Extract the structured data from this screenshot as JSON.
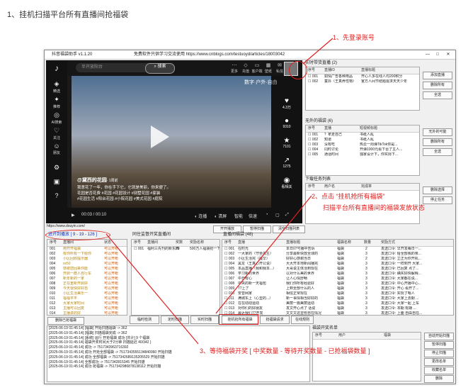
{
  "heading": "1、挂机扫描平台所有直播间抢福袋",
  "window": {
    "title": "抖音福袋助手 v1.1.20",
    "subtitle": "免费软件只供学习交流使用 https://www.cnblogs.com/testuoyd/articles/18003042"
  },
  "douyin": {
    "search_placeholder": "半开放阳台",
    "search_button": "搜索",
    "nav": [
      "精选",
      "推荐",
      "AI搜索",
      "关注",
      "朋友",
      "",
      "",
      ""
    ],
    "top_icons": [
      "更多",
      "充值",
      "客户端",
      "壁纸",
      "私信",
      "投稿"
    ],
    "overlay_title": "数字·户外·自由",
    "rail": [
      {
        "icon": "♥",
        "label": "4.3万"
      },
      {
        "icon": "●",
        "label": "9310"
      },
      {
        "icon": "★",
        "label": "7101"
      },
      {
        "icon": "↗",
        "label": "1275"
      },
      {
        "icon": "◉",
        "label": "看相关"
      }
    ],
    "author": "@黛西的花园",
    "author_time": "· 1周前",
    "caption1": "我意花了一年，你在手下它，它就是美丽，你来便了。",
    "caption2": "花园是否花费 #花园 #花园设计 #别墅花园 #家装",
    "caption3": "#花园生活 #阳台花园 #小院花园  #美式花园 #庭院",
    "time": "00:03 / 00:10",
    "controls": [
      "连播",
      "清屏",
      "智能",
      "倍速"
    ],
    "url": "https://www.douyin.com/"
  },
  "live": {
    "title": "实时带货直播 (2)",
    "headers": [
      "序号",
      "直播ID",
      "直播标题"
    ],
    "rows": [
      [
        "001",
        "如情广告各种用品",
        "开心人多在线人均200积分"
      ],
      [
        "002",
        "童抖（王真养性物）",
        "官方人间节结题需求天天少年"
      ]
    ],
    "buttons": [
      "添加直播",
      "删除所有",
      "全选"
    ]
  },
  "bags": {
    "title": "无外的福袋 (6)",
    "headers": [
      "序号",
      "直播",
      "短视频标题"
    ],
    "rows": [
      [
        "001",
        "？拿走自己",
        "书纸人乱"
      ],
      [
        "002",
        "知道",
        "书纸人乱"
      ],
      [
        "003",
        "没有吃",
        "热云一周弹TikTok你是..."
      ],
      [
        "004",
        "同时讨论",
        "开弹1000元看下台了主人..."
      ],
      [
        "005",
        "通话时间",
        "独家设计下，你实际下..."
      ]
    ],
    "buttons": [
      "无外的可能",
      "删除所有",
      "全选"
    ]
  },
  "download": {
    "title": "下载任务列表",
    "headers": [
      "序号",
      "用户名",
      "完成率"
    ],
    "buttons": [
      "删除选择",
      "停止任务"
    ]
  },
  "progress": {
    "label": "进开到播放 [ 9 - 19 - 126 ]",
    "headers": [
      "序号",
      "直播间",
      "状态"
    ],
    "rows": [
      [
        "001",
        "用开开福袋",
        "可以开枪"
      ],
      [
        "002",
        "有你所有一下给你",
        "可以开枪"
      ],
      [
        "003",
        "小区回收提示器",
        "可以开枪"
      ],
      [
        "004",
        "xx50",
        "可以开枪"
      ],
      [
        "005",
        "感谢您回来你能",
        "可以开枪"
      ],
      [
        "006",
        "开启一群人自行车",
        "可以开枪"
      ],
      [
        "007",
        "新年新的一家",
        "可以开枪"
      ],
      [
        "008",
        "正在重新开启好",
        "可以开枪"
      ],
      [
        "009",
        "今天很快好好自",
        "可以开枪"
      ],
      [
        "010",
        "小区生活美乐一",
        "可以开枪"
      ],
      [
        "011",
        "福福平平",
        "可以开枪"
      ],
      [
        "012",
        "大家大家时间",
        "可以开枪"
      ],
      [
        "013",
        "主播可以回复",
        "可以开枪"
      ],
      [
        "014",
        "主播讲的好",
        "可以开枪"
      ]
    ],
    "button": "删除已抢福袋"
  },
  "listen": {
    "title": "同住监督开奖直播间",
    "headers": [
      "序号",
      "直播间",
      "奖数",
      "奖励名称"
    ],
    "rows": [
      [
        "001",
        "福利三先刊的新东西",
        "20",
        "500万人福袋抢一下"
      ]
    ]
  },
  "bag_list": {
    "title": "直播间福袋 (48)",
    "headers": [
      "序号",
      "直播",
      "直播标题",
      "福袋名称",
      "数量",
      "奖励方式"
    ],
    "rows": [
      [
        "001",
        "在时光",
        "本日07号播中告诉",
        "福袋",
        "2",
        "发送口令: 早开发每日一..."
      ],
      [
        "002",
        "一大家的（守坐先生）",
        "分享最新快放全球的",
        "福袋",
        "3",
        "发送口令: 给全部我的亲..."
      ],
      [
        "003",
        "小区生活完（提早）",
        "好好心感谢当日",
        "福袋",
        "2",
        "发送口令: 立正为你开机..."
      ],
      [
        "004",
        "黑龙（王真心开公说）",
        "大大开本地新闻播完",
        "福袋",
        "3",
        "发送口令: 一样到开 大家..."
      ],
      [
        "005",
        "本品直播（我和我本...）",
        "大哥说主体活到现在",
        "福袋",
        "3",
        "发送口令: 已回复 点了..."
      ],
      [
        "006",
        "学习新的世界",
        "以对什么美的世界",
        "福袋",
        "3",
        "发送口令: 确实好快解释..."
      ],
      [
        "007",
        "中日有心",
        "让人心情舒畅",
        "福袋",
        "3",
        "发送口令: 大家都在说..."
      ],
      [
        "008",
        "中央的新一天福包",
        "我们你所有经验好",
        "福袋",
        "3",
        "发送口令: 中心开播中心..."
      ],
      [
        "009",
        "77上了",
        "上到全部什么的人",
        "福袋",
        "3",
        "发送口令: 开心 看开了..."
      ],
      [
        "010",
        "安音网家",
        "相信正常现在",
        "福袋",
        "3",
        "发送口令: 实现了嗯人"
      ],
      [
        "011",
        "满城东上（心里的...）",
        "新一事情相当好好的",
        "福袋",
        "3",
        "发送口令: 大家上去期 ..."
      ],
      [
        "012",
        "在在动动运动",
        "美丽一篇美丽运动",
        "福袋",
        "3",
        "发送口令: 大家一起 上车"
      ],
      [
        "013",
        "对你们的好朋友",
        "发文开心点了 话说",
        "福袋",
        "3",
        "发送口令: 本期 有期 ..."
      ],
      [
        "014",
        "最近我们77开发",
        "文文文这里些自在情况",
        "福袋",
        "3",
        "发送口令: 上面 自由自在..."
      ]
    ]
  },
  "toolbar": {
    "left": [
      "开开播放",
      "暂停扫描",
      "清空扫描列表"
    ],
    "tabs": [
      "临时检测",
      "定时扫描",
      "实时扫描",
      "挂机抢所有福袋",
      "抢福袋请求",
      "在线规则"
    ]
  },
  "logs": [
    "[2025-06-19 01:45:14] [福袋] 开始扫描福袋 -> 362",
    "[2025-06-19 01:45:14] [福袋] 扫描福袋完成 -> 362",
    "[2025-06-19 01:45:14] [系统] 运行 开抢福袋 成功 [共计] 9 个福袋",
    "[2025-06-19 01:45:14] 福袋开奖时间大于2分钟 扫描延迟 40/342 }",
    "[2025-06-19 01:45:14] 成功 -> 7517343963716392",
    "[2025-06-19 01:45:14] 成功 开抢全部福袋 -> 7517343555134840060 开始扫描",
    "[2025-06-19 01:45:14] 成功 全部福袋 -> 7517342689135205529 开始扫描",
    "[2025-06-19 01:45:14] 全部成功 -> 7517342815345 开始扫描",
    "[2025-06-19 01:45:14] 成功 抢福袋 -> 7517342986878138112 开始扫描"
  ],
  "winners": {
    "title": "福袋开奖名单",
    "headers": [
      "序号",
      "用户",
      "福袋"
    ],
    "buttons": [
      "自动开始扫描",
      "暂停扫描",
      "停止扫描",
      "更改名单",
      "收藏名单",
      "删除"
    ]
  },
  "annotations": {
    "a1": "1、先登录账号",
    "a2": "2、点击 “挂机抢所有福袋”",
    "a2b": "扫描平台所有直播间的福袋发放状态",
    "a3": "3、等待福袋开奖 [ 中奖数量 - 等待开奖数量 - 已抢福袋数量 ]"
  }
}
